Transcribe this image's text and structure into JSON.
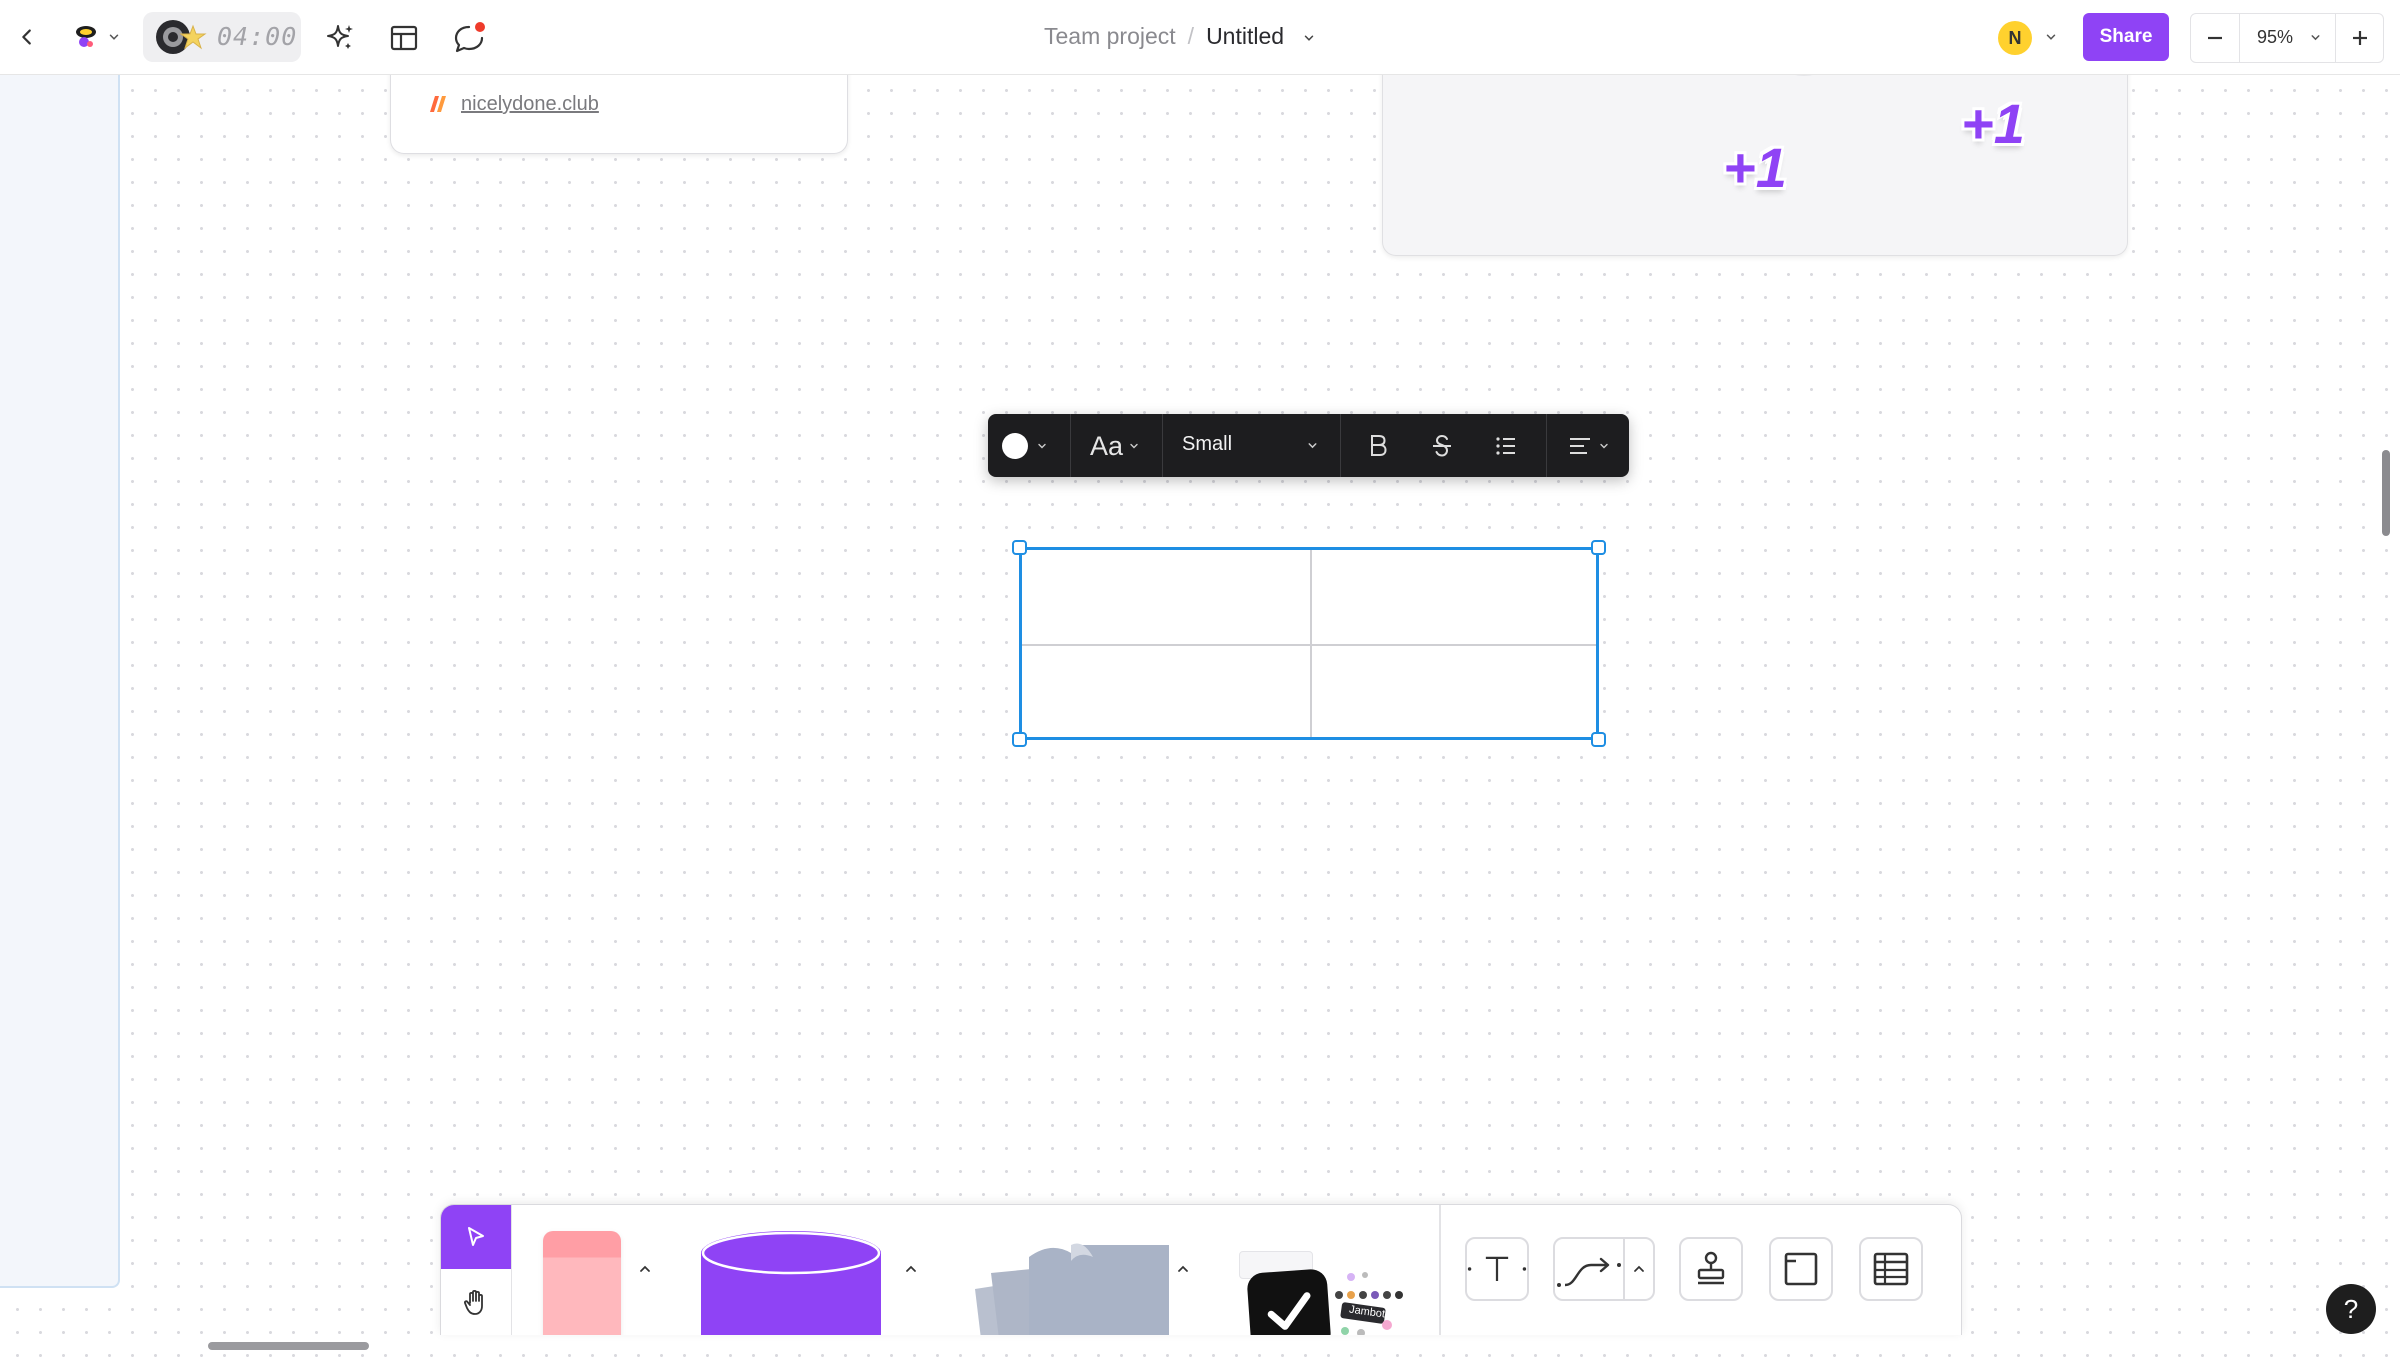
{
  "topbar": {
    "timer": "04:00",
    "breadcrumb_team": "Team project",
    "breadcrumb_separator": "/",
    "doc_title": "Untitled",
    "avatar_initial": "N",
    "share_label": "Share",
    "zoom_value": "95%"
  },
  "canvas": {
    "link_card_text": "nicelydone.club",
    "stickers": [
      "+1",
      "+1"
    ]
  },
  "format_toolbar": {
    "font_label": "Aa",
    "size_value": "Small"
  },
  "dock": {
    "sticker_label": "Jambot"
  },
  "help_label": "?",
  "colors": {
    "accent": "#8f43f5",
    "selection": "#1e8ee3",
    "sticky_note": "#ffb3b8",
    "shape": "#8f43f5",
    "paper": "#a9b3c6"
  }
}
